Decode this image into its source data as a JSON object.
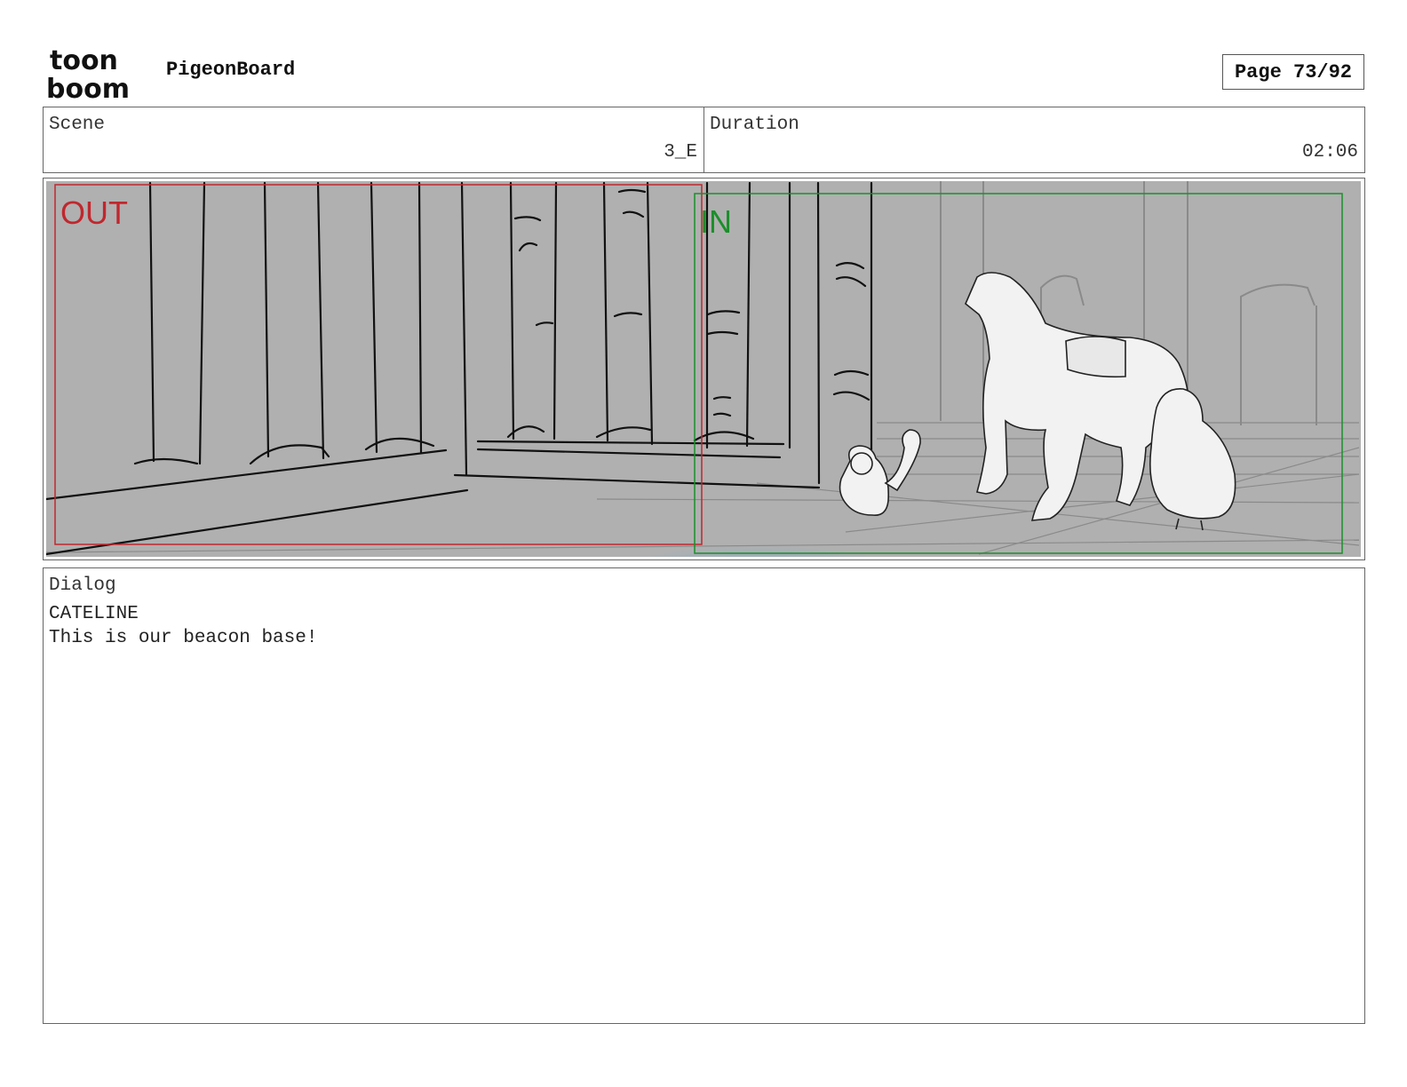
{
  "header": {
    "brand_top": "toon",
    "brand_bottom": "boom",
    "app_name": "PigeonBoard",
    "page_label": "Page 73/92"
  },
  "info": {
    "scene_label": "Scene",
    "scene_value": "3_E",
    "duration_label": "Duration",
    "duration_value": "02:06"
  },
  "panel": {
    "out_label": "OUT",
    "in_label": "IN",
    "colors": {
      "background": "#b0b0b0",
      "out_frame": "#c0272d",
      "in_frame": "#1a8f2a",
      "sketch": "#111111"
    }
  },
  "dialog": {
    "label": "Dialog",
    "speaker": "CATELINE",
    "line": "This is our beacon base!"
  }
}
